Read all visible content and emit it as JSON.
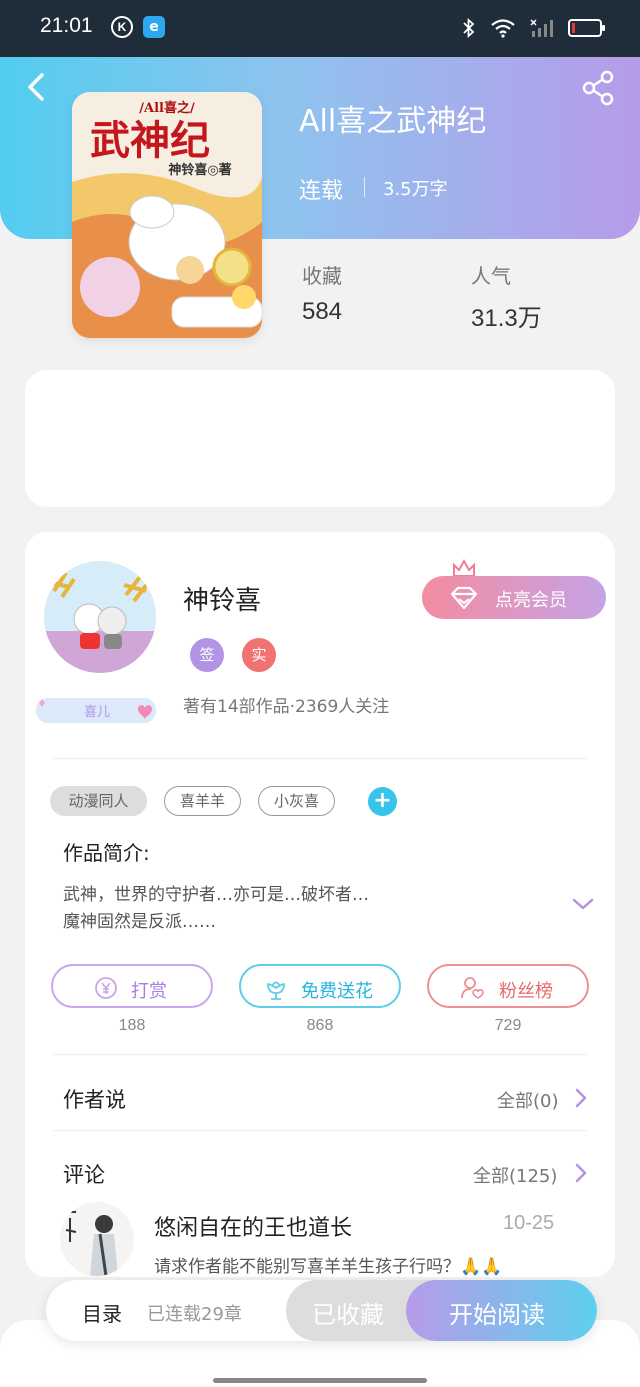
{
  "status_bar": {
    "time": "21:01",
    "icons": [
      "k-app-icon",
      "e-app-icon",
      "bluetooth-icon",
      "wifi-icon",
      "signal-icon",
      "battery-icon"
    ]
  },
  "book": {
    "title": "All喜之武神纪",
    "status": "连载",
    "word_count": "3.5万字",
    "cover_text": {
      "series": "/All喜之/",
      "title": "武神纪",
      "author": "神铃喜◎著"
    },
    "stats": [
      {
        "label": "收藏",
        "value": "584"
      },
      {
        "label": "人气",
        "value": "31.3万"
      }
    ]
  },
  "author": {
    "name": "神铃喜",
    "badges": {
      "sign": "签",
      "real": "实"
    },
    "nickname_tag": "喜儿",
    "stats_text": "著有14部作品·2369人关注",
    "vip_button": "点亮会员"
  },
  "tags": [
    "动漫同人",
    "喜羊羊",
    "小灰喜"
  ],
  "intro": {
    "title": "作品简介:",
    "lines": [
      "武神，世界的守护者…亦可是…破坏者…",
      "魔神固然是反派……"
    ]
  },
  "actions": [
    {
      "label": "打赏",
      "count": "188",
      "icon": "yen-icon"
    },
    {
      "label": "免费送花",
      "count": "868",
      "icon": "flower-icon"
    },
    {
      "label": "粉丝榜",
      "count": "729",
      "icon": "fan-heart-icon"
    }
  ],
  "author_says": {
    "title": "作者说",
    "link": "全部(0)"
  },
  "comments": {
    "title": "评论",
    "link": "全部(125)",
    "items": [
      {
        "name": "悠闲自在的王也道长",
        "date": "10-25",
        "text": "请求作者能不能别写喜羊羊生孩子行吗？🙏🙏"
      }
    ]
  },
  "bottom": {
    "toc_label": "目录",
    "chapter_count": "已连载29章",
    "collected_label": "已收藏",
    "read_label": "开始阅读"
  },
  "colors": {
    "header_gradient": [
      "#52cdf0",
      "#b79be9"
    ],
    "vip_gradient": [
      "#f48ca0",
      "#c5a3e6"
    ],
    "reward": "#a87fe0",
    "flower": "#27b4dc",
    "fans": "#e46a6a"
  }
}
